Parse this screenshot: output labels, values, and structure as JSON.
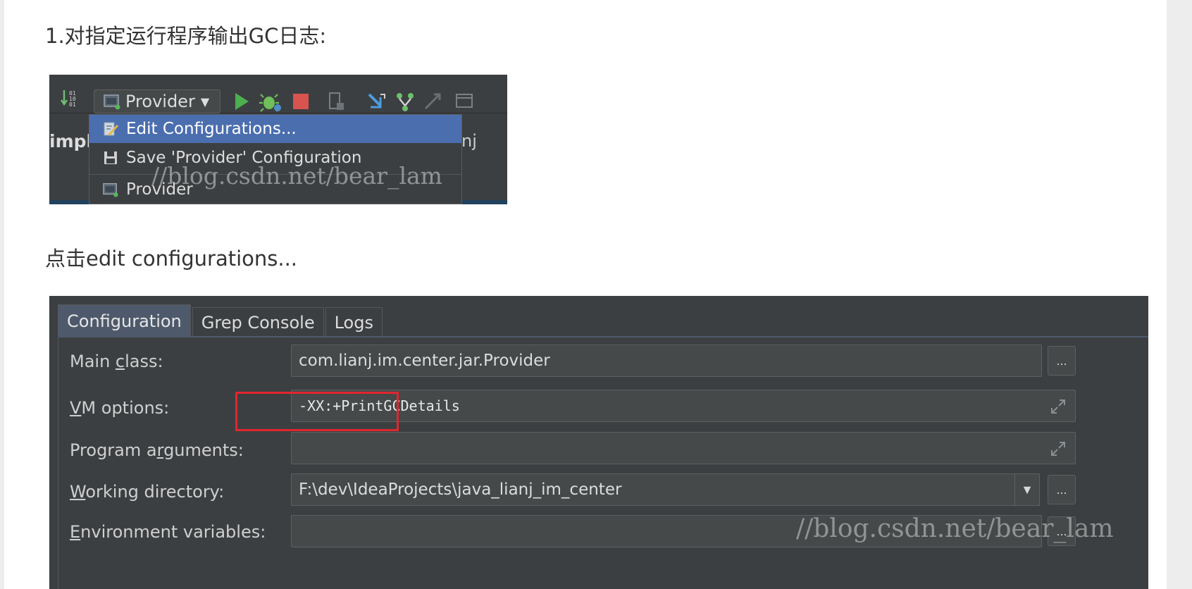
{
  "article": {
    "step1_text": "1.对指定运行程序输出GC日志:",
    "step2_text": "点击edit configurations..."
  },
  "toolbar": {
    "run_config_label": "Provider",
    "run_config_caret": "▼"
  },
  "editor_bg": {
    "left_text": "impl",
    "right_text": "nj"
  },
  "run_menu": {
    "items": [
      {
        "label": "Edit Configurations...",
        "icon": "edit-config-icon",
        "selected": true
      },
      {
        "label": "Save 'Provider' Configuration",
        "icon": "save-icon",
        "selected": false
      },
      {
        "label": "Provider",
        "icon": "app-config-icon",
        "selected": false
      }
    ]
  },
  "watermark": "//blog.csdn.net/bear_lam",
  "config_dialog": {
    "tabs": [
      {
        "label": "Configuration",
        "active": true
      },
      {
        "label": "Grep Console",
        "active": false
      },
      {
        "label": "Logs",
        "active": false
      }
    ],
    "fields": {
      "main_class": {
        "label_pre": "Main ",
        "label_mn": "c",
        "label_post": "lass:",
        "value": "com.lianj.im.center.jar.Provider"
      },
      "vm_options": {
        "label_pre": "",
        "label_mn": "V",
        "label_post": "M options:",
        "value": "-XX:+PrintGCDetails"
      },
      "program_arguments": {
        "label_pre": "Program a",
        "label_mn": "r",
        "label_post": "guments:",
        "value": ""
      },
      "working_directory": {
        "label_pre": "",
        "label_mn": "W",
        "label_post": "orking directory:",
        "value": "F:\\dev\\IdeaProjects\\java_lianj_im_center"
      },
      "environment_variables": {
        "label_pre": "",
        "label_mn": "E",
        "label_post": "nvironment variables:",
        "value": ""
      }
    },
    "browse_label": "...",
    "dropdown_caret": "▼"
  },
  "colors": {
    "ide_bg": "#3c3f41",
    "selection": "#4b6eaf",
    "highlight_box": "#e0262e",
    "run_green": "#4caf50",
    "stop_red": "#d9534f"
  }
}
